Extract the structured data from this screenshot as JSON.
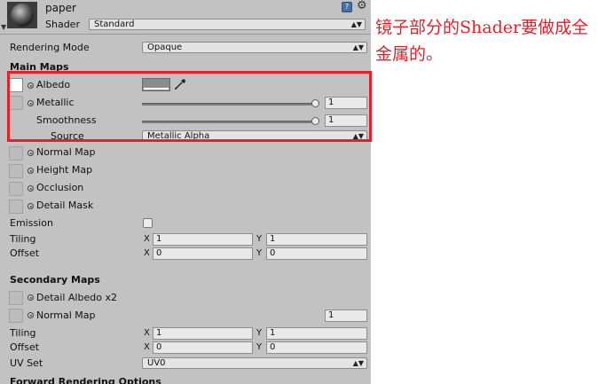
{
  "header": {
    "material_name": "paper",
    "shader_label": "Shader",
    "shader_value": "Standard"
  },
  "rendering_mode": {
    "label": "Rendering Mode",
    "value": "Opaque"
  },
  "main_maps": {
    "title": "Main Maps",
    "albedo_label": "Albedo",
    "metallic_label": "Metallic",
    "metallic_value": "1",
    "smoothness_label": "Smoothness",
    "smoothness_value": "1",
    "source_label": "Source",
    "source_value": "Metallic Alpha",
    "normal_map_label": "Normal Map",
    "height_map_label": "Height Map",
    "occlusion_label": "Occlusion",
    "detail_mask_label": "Detail Mask",
    "emission_label": "Emission",
    "tiling_label": "Tiling",
    "tiling_x": "1",
    "tiling_y": "1",
    "offset_label": "Offset",
    "offset_x": "0",
    "offset_y": "0"
  },
  "secondary_maps": {
    "title": "Secondary Maps",
    "detail_albedo_label": "Detail Albedo x2",
    "normal_map_label": "Normal Map",
    "normal_map_value": "1",
    "tiling_label": "Tiling",
    "tiling_x": "1",
    "tiling_y": "1",
    "offset_label": "Offset",
    "offset_x": "0",
    "offset_y": "0",
    "uv_set_label": "UV Set",
    "uv_set_value": "UV0"
  },
  "forward_rendering_label": "Forward Rendering Options",
  "axis": {
    "x": "X",
    "y": "Y"
  },
  "annotation": "镜子部分的Shader要做成全金属的。",
  "colors": {
    "highlight": "#e3212a",
    "panel": "#c2c2c2"
  }
}
